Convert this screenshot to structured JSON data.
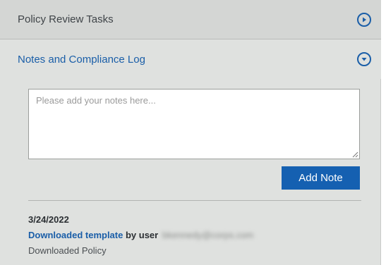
{
  "sections": {
    "review": {
      "title": "Policy Review Tasks",
      "icon": "play-circle-icon"
    },
    "notes": {
      "title": "Notes and Compliance Log",
      "icon": "chevron-down-circle-icon",
      "placeholder": "Please add your notes here...",
      "value": "",
      "add_button_label": "Add Note"
    }
  },
  "log": [
    {
      "date": "3/24/2022",
      "action": "Downloaded template",
      "by_user": " by user",
      "user_email": "bkennedy@corps.com",
      "detail": "Downloaded Policy"
    }
  ],
  "colors": {
    "accent": "#1a5ea8",
    "button": "#1560b1",
    "panel_bg": "#dfe1df",
    "header_bg": "#d4d6d4"
  }
}
